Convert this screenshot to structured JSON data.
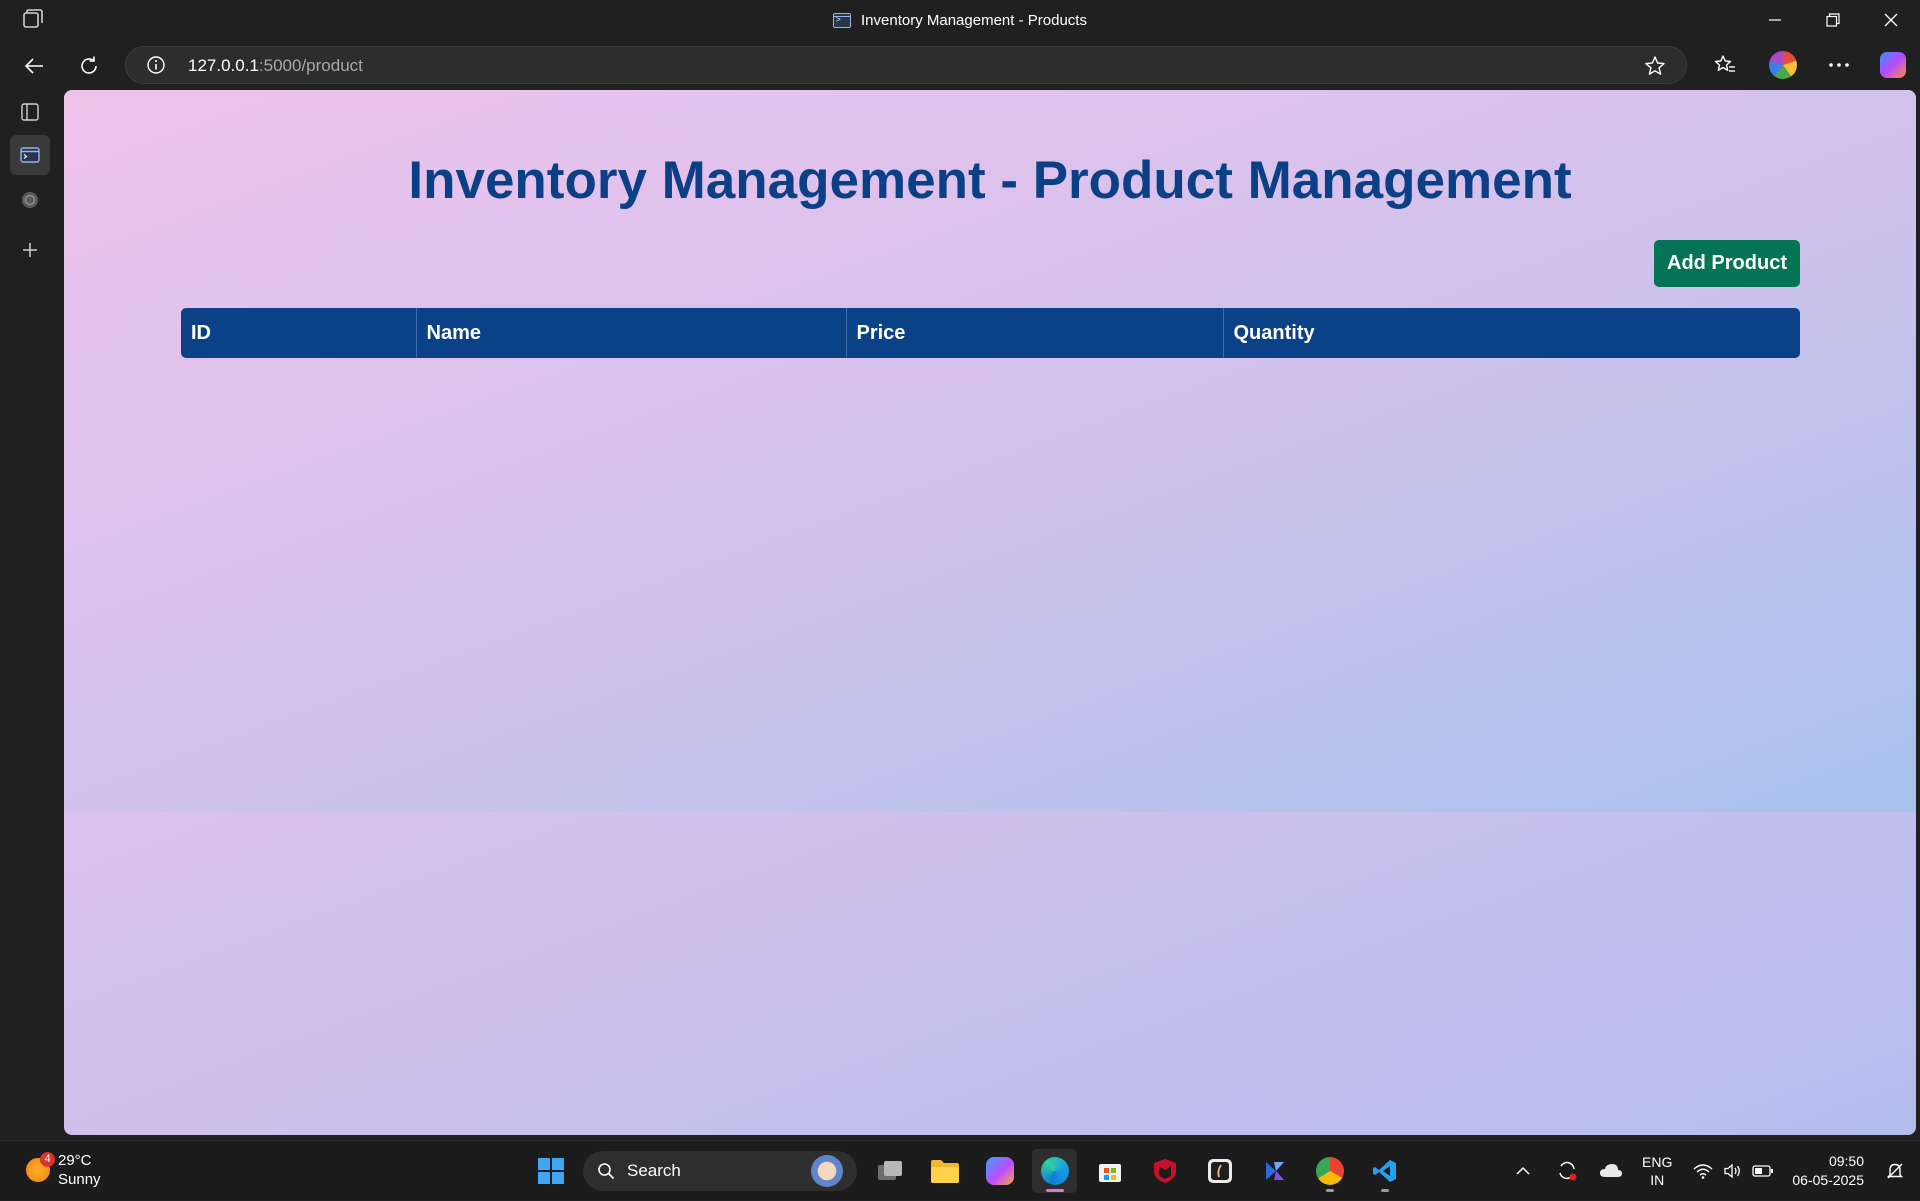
{
  "window": {
    "title": "Inventory Management - Products"
  },
  "address_bar": {
    "host": "127.0.0.1",
    "path": ":5000/product"
  },
  "page": {
    "title": "Inventory Management - Product Management",
    "add_button_label": "Add Product",
    "table": {
      "columns": [
        "ID",
        "Name",
        "Price",
        "Quantity"
      ],
      "rows": []
    }
  },
  "taskbar": {
    "weather": {
      "temperature": "29°C",
      "condition": "Sunny",
      "badge": "4"
    },
    "search_label": "Search",
    "language": {
      "line1": "ENG",
      "line2": "IN"
    },
    "clock": {
      "time": "09:50",
      "date": "06-05-2025"
    }
  },
  "colors": {
    "title_text": "#0b3f86",
    "table_header": "#0b4187",
    "add_button": "#047455"
  }
}
